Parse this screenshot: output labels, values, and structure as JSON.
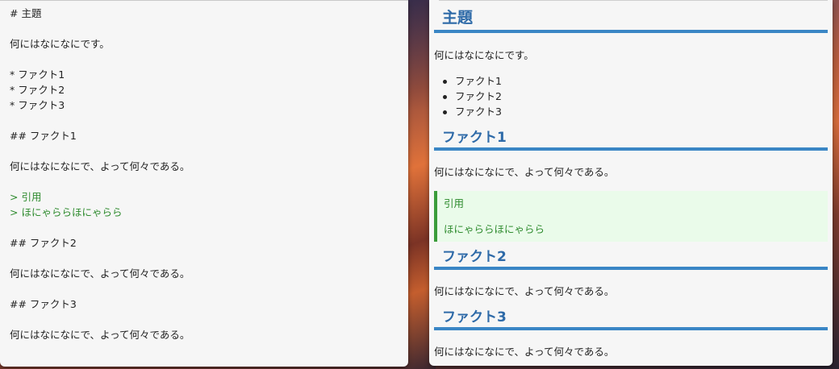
{
  "editor": {
    "lines": [
      {
        "text": "# 主題",
        "kind": "normal"
      },
      {
        "text": "",
        "kind": "normal"
      },
      {
        "text": "何にはなになにです。",
        "kind": "normal"
      },
      {
        "text": "",
        "kind": "normal"
      },
      {
        "text": "* ファクト1",
        "kind": "normal"
      },
      {
        "text": "* ファクト2",
        "kind": "normal"
      },
      {
        "text": "* ファクト3",
        "kind": "normal"
      },
      {
        "text": "",
        "kind": "normal"
      },
      {
        "text": "## ファクト1",
        "kind": "normal"
      },
      {
        "text": "",
        "kind": "normal"
      },
      {
        "text": "何にはなになにで、よって何々である。",
        "kind": "normal"
      },
      {
        "text": "",
        "kind": "normal"
      },
      {
        "text": "> 引用",
        "kind": "quote"
      },
      {
        "text": "> ほにゃららほにゃらら",
        "kind": "quote"
      },
      {
        "text": "",
        "kind": "normal"
      },
      {
        "text": "## ファクト2",
        "kind": "normal"
      },
      {
        "text": "",
        "kind": "normal"
      },
      {
        "text": "何にはなになにで、よって何々である。",
        "kind": "normal"
      },
      {
        "text": "",
        "kind": "normal"
      },
      {
        "text": "## ファクト3",
        "kind": "normal"
      },
      {
        "text": "",
        "kind": "normal"
      },
      {
        "text": "何にはなになにで、よって何々である。",
        "kind": "normal"
      }
    ]
  },
  "preview": {
    "h1": "主題",
    "intro": "何にはなになにです。",
    "list": [
      "ファクト1",
      "ファクト2",
      "ファクト3"
    ],
    "fact1": {
      "heading": "ファクト1",
      "body": "何にはなになにで、よって何々である。",
      "quote_line1": "引用",
      "quote_line2": "ほにゃららほにゃらら"
    },
    "fact2": {
      "heading": "ファクト2",
      "body": "何にはなになにで、よって何々である。"
    },
    "fact3": {
      "heading": "ファクト3",
      "body": "何にはなになにで、よって何々である。"
    }
  },
  "colors": {
    "heading": "#2e6aa8",
    "heading_rule": "#3a86c5",
    "quote_text": "#2e8b2e",
    "quote_bar": "#3a9c3a",
    "quote_bg": "#eafbea"
  }
}
